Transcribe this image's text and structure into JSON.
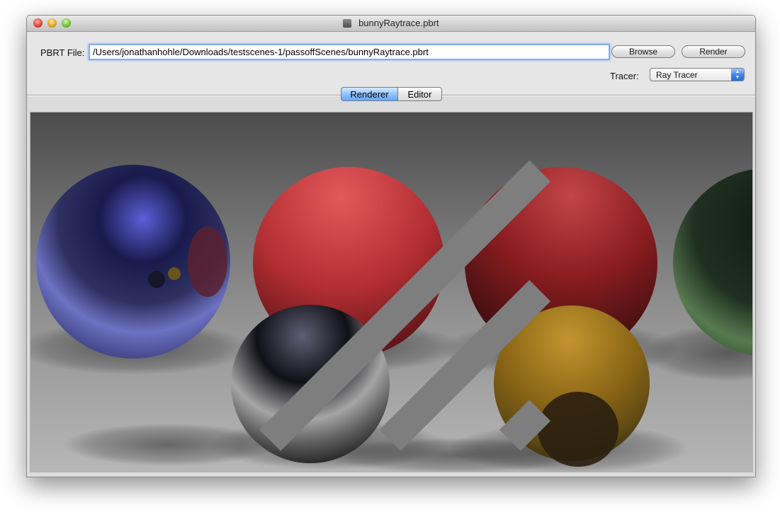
{
  "window": {
    "title": "bunnyRaytrace.pbrt"
  },
  "form": {
    "pbrt_label": "PBRT File:",
    "path_value": "/Users/jonathanhohle/Downloads/testscenes-1/passoffScenes/bunnyRaytrace.pbrt",
    "browse_label": "Browse",
    "render_label": "Render",
    "tracer_label": "Tracer:",
    "tracer_value": "Ray Tracer"
  },
  "tabs": [
    {
      "label": "Renderer",
      "selected": true
    },
    {
      "label": "Editor",
      "selected": false
    }
  ],
  "render": {
    "spheres": [
      {
        "name": "blue mirror sphere",
        "color": "#4b4f9d"
      },
      {
        "name": "red sphere",
        "color": "#c93a3d"
      },
      {
        "name": "dark red sphere",
        "color": "#9b1f22"
      },
      {
        "name": "green mirror sphere",
        "color": "#2f4f2e"
      },
      {
        "name": "chrome sphere",
        "color": "#8d8d8d"
      },
      {
        "name": "yellow glass sphere",
        "color": "#8a6515"
      }
    ]
  },
  "colors": {
    "accent": "#5b9df2",
    "window_background": "#e8e8e8"
  }
}
